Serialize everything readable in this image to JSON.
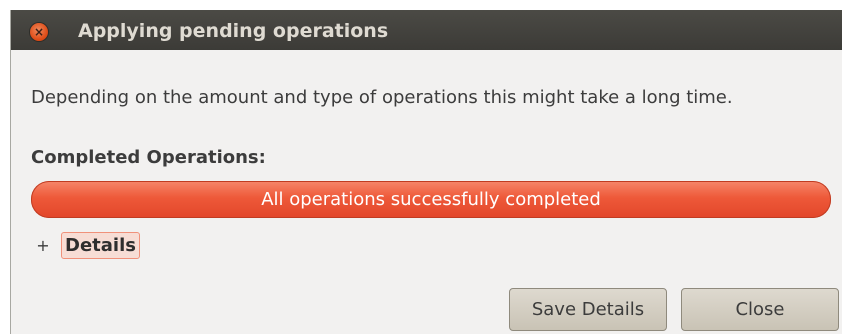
{
  "window": {
    "title": "Applying pending operations",
    "close_glyph": "×"
  },
  "body": {
    "description": "Depending on the amount and type of operations this might take a long time.",
    "completed_label": "Completed Operations:",
    "progress": {
      "text": "All operations successfully completed",
      "fraction": 1.0
    },
    "details": {
      "toggle": "+",
      "label": "Details"
    }
  },
  "buttons": {
    "save_details": "Save Details",
    "close": "Close"
  },
  "colors": {
    "titlebar": "#3c3b37",
    "window_bg": "#f2f1f0",
    "progress_fill": "#ee5939",
    "close_button": "#df4b16"
  }
}
